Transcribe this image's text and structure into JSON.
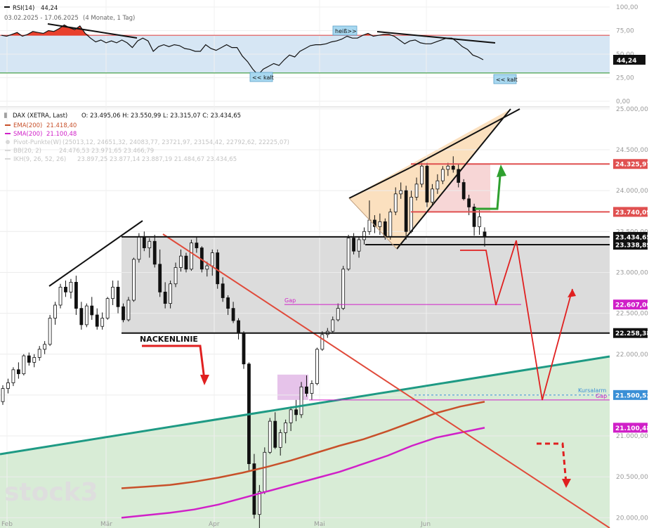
{
  "rsi_panel": {
    "title": "RSI(14)",
    "value": "44,24",
    "subtitle": "03.02.2025 - 17.06.2025",
    "subtitle_detail": "(4 Monate, 1 Tag)",
    "badge": "44,24",
    "labels": {
      "heiss": "heiß>>",
      "kalt1": "<< kalt",
      "kalt2": "<< kalt"
    }
  },
  "legend": {
    "main": {
      "name": "DAX (XETRA, Last)",
      "ohlc": "O: 23.495,06   H: 23.550,99   L: 23.315,07   C: 23.434,65"
    },
    "ema": {
      "name": "EMA(200)",
      "value": "21.418,40",
      "color": "#c8502a"
    },
    "sma": {
      "name": "SMA(200)",
      "value": "21.100,48",
      "color": "#d020c8"
    },
    "pivot": {
      "name": "Pivot-Punkte(W)",
      "value": "(25013,12, 24651,32, 24083,77, 23721,97, 23154,42, 22792,62, 22225,07)"
    },
    "bb": {
      "name": "BB(20, 2)",
      "value": "24.476,53  23.971,65  23.466,79"
    },
    "ikh": {
      "name": "IKH(9, 26, 52, 26)",
      "value": "23.897,25  23.877,14  23.887,19  21.484,67  23.434,65"
    }
  },
  "annotations": {
    "nackenlinie": "NACKENLINIE",
    "gap_upper": "Gap",
    "gap_lower": "Gap",
    "kursalarm": "Kursalarm"
  },
  "watermark": "stock3",
  "level_badges": [
    {
      "text": "24.325,97",
      "value": 24325.97,
      "color": "#e05050"
    },
    {
      "text": "23.740,09",
      "value": 23740.09,
      "color": "#e05050"
    },
    {
      "text": "23.434,65",
      "value": 23434.65,
      "color": "#111111"
    },
    {
      "text": "23.338,89",
      "value": 23338.89,
      "color": "#111111"
    },
    {
      "text": "22.607,00",
      "value": 22607.0,
      "color": "#d020c8"
    },
    {
      "text": "22.258,38",
      "value": 22258.38,
      "color": "#111111"
    },
    {
      "text": "21.500,53",
      "value": 21500.53,
      "color": "#3a8fd6"
    },
    {
      "text": "21.100,48",
      "value": 21100.48,
      "color": "#d020c8"
    }
  ],
  "chart_data": [
    {
      "type": "line",
      "title": "RSI(14)",
      "y_ticks": [
        "100,00",
        "75,00",
        "50,00",
        "25,00",
        "0,00"
      ],
      "y_values": [
        100,
        75,
        50,
        25,
        0
      ],
      "ylim": [
        0,
        100
      ],
      "overbought": 70,
      "oversold": 30,
      "series": [
        {
          "name": "RSI(14)",
          "values": [
            70,
            69,
            71,
            73,
            69,
            71,
            74,
            73,
            72,
            75,
            74,
            77,
            81,
            78,
            76,
            80,
            72,
            67,
            63,
            65,
            62,
            64,
            62,
            65,
            62,
            57,
            64,
            67,
            64,
            53,
            58,
            60,
            58,
            60,
            59,
            56,
            55,
            53,
            53,
            60,
            56,
            54,
            57,
            60,
            57,
            57,
            48,
            42,
            34,
            28,
            34,
            37,
            40,
            38,
            44,
            49,
            47,
            53,
            56,
            59,
            60,
            60,
            61,
            63,
            64,
            66,
            69,
            67,
            67,
            70,
            72,
            69,
            70,
            71,
            71,
            69,
            65,
            61,
            64,
            65,
            62,
            61,
            61,
            63,
            65,
            67,
            67,
            63,
            58,
            55,
            49,
            47,
            44
          ]
        }
      ]
    },
    {
      "type": "candlestick",
      "title": "DAX (XETRA, Last)",
      "x_ticks": [
        "Feb",
        "Mär",
        "Apr",
        "Mai",
        "Jun"
      ],
      "y_ticks": [
        "25.000,00",
        "24.500,00",
        "24.000,00",
        "23.500,00",
        "23.000,00",
        "22.500,00",
        "22.000,00",
        "21.500,00",
        "21.000,00",
        "20.500,00",
        "20.000,00"
      ],
      "y_values": [
        25000,
        24500,
        24000,
        23500,
        23000,
        22500,
        22000,
        21500,
        21000,
        20500,
        20000
      ],
      "ylim": [
        19950,
        25150
      ],
      "ohlc": [
        [
          21420,
          21620,
          21380,
          21580
        ],
        [
          21580,
          21700,
          21520,
          21650
        ],
        [
          21650,
          21840,
          21610,
          21810
        ],
        [
          21810,
          21900,
          21700,
          21760
        ],
        [
          21760,
          22000,
          21740,
          21980
        ],
        [
          21980,
          22020,
          21860,
          21900
        ],
        [
          21900,
          22000,
          21840,
          21960
        ],
        [
          21960,
          22100,
          21920,
          22060
        ],
        [
          22060,
          22160,
          22000,
          22120
        ],
        [
          22120,
          22480,
          22100,
          22440
        ],
        [
          22440,
          22640,
          22360,
          22600
        ],
        [
          22600,
          22860,
          22560,
          22820
        ],
        [
          22820,
          22900,
          22700,
          22760
        ],
        [
          22760,
          22920,
          22680,
          22880
        ],
        [
          22880,
          22960,
          22480,
          22560
        ],
        [
          22560,
          22640,
          22300,
          22360
        ],
        [
          22360,
          22620,
          22330,
          22590
        ],
        [
          22590,
          22700,
          22420,
          22480
        ],
        [
          22480,
          22560,
          22300,
          22340
        ],
        [
          22340,
          22510,
          22300,
          22440
        ],
        [
          22440,
          22700,
          22420,
          22680
        ],
        [
          22680,
          22900,
          22600,
          22820
        ],
        [
          22820,
          22900,
          22500,
          22580
        ],
        [
          22580,
          22620,
          22390,
          22420
        ],
        [
          22420,
          22700,
          22400,
          22660
        ],
        [
          22660,
          23180,
          22640,
          23160
        ],
        [
          23160,
          23480,
          23120,
          23440
        ],
        [
          23440,
          23500,
          23260,
          23300
        ],
        [
          23300,
          23420,
          23180,
          23380
        ],
        [
          23380,
          23460,
          23060,
          23100
        ],
        [
          23100,
          23280,
          22700,
          22760
        ],
        [
          22760,
          22880,
          22560,
          22620
        ],
        [
          22620,
          22900,
          22560,
          22860
        ],
        [
          22860,
          23120,
          22820,
          23060
        ],
        [
          23060,
          23280,
          23010,
          23200
        ],
        [
          23200,
          23240,
          23000,
          23040
        ],
        [
          23040,
          23400,
          23020,
          23360
        ],
        [
          23360,
          23440,
          23240,
          23300
        ],
        [
          23300,
          23320,
          23000,
          23040
        ],
        [
          23040,
          23130,
          22950,
          23080
        ],
        [
          23080,
          23280,
          22960,
          23240
        ],
        [
          23240,
          23280,
          22800,
          22860
        ],
        [
          22860,
          22940,
          22640,
          22690
        ],
        [
          22690,
          22720,
          22480,
          22560
        ],
        [
          22560,
          22640,
          22380,
          22410
        ],
        [
          22410,
          22440,
          22180,
          22260
        ],
        [
          22260,
          22280,
          21820,
          21880
        ],
        [
          21880,
          21900,
          20580,
          20660
        ],
        [
          20660,
          20780,
          19990,
          20040
        ],
        [
          20040,
          20400,
          19800,
          20320
        ],
        [
          20320,
          20860,
          20290,
          20800
        ],
        [
          20800,
          21220,
          20780,
          21180
        ],
        [
          21180,
          21290,
          20840,
          20860
        ],
        [
          20860,
          21080,
          20760,
          21040
        ],
        [
          21040,
          21200,
          20910,
          21160
        ],
        [
          21160,
          21360,
          21060,
          21320
        ],
        [
          21320,
          21440,
          21180,
          21260
        ],
        [
          21260,
          21660,
          21220,
          21600
        ],
        [
          21600,
          21740,
          21480,
          21520
        ],
        [
          21520,
          21680,
          21440,
          21640
        ],
        [
          21640,
          22080,
          21620,
          22060
        ],
        [
          22060,
          22280,
          22040,
          22240
        ],
        [
          22240,
          22320,
          22200,
          22280
        ],
        [
          22280,
          22460,
          22260,
          22420
        ],
        [
          22420,
          22620,
          22400,
          22560
        ],
        [
          22560,
          23080,
          22540,
          23040
        ],
        [
          23040,
          23460,
          23020,
          23420
        ],
        [
          23420,
          23480,
          23220,
          23260
        ],
        [
          23260,
          23440,
          23180,
          23400
        ],
        [
          23400,
          23550,
          23340,
          23500
        ],
        [
          23500,
          23880,
          23460,
          23640
        ],
        [
          23640,
          23700,
          23480,
          23560
        ],
        [
          23560,
          23720,
          23460,
          23620
        ],
        [
          23620,
          23660,
          23400,
          23440
        ],
        [
          23440,
          23780,
          23400,
          23740
        ],
        [
          23740,
          24040,
          23700,
          23960
        ],
        [
          23960,
          24100,
          23900,
          24000
        ],
        [
          24000,
          24060,
          23400,
          23500
        ],
        [
          23500,
          24000,
          23480,
          23920
        ],
        [
          23920,
          24160,
          23880,
          24080
        ],
        [
          24080,
          24340,
          24040,
          24300
        ],
        [
          24300,
          24340,
          23800,
          23860
        ],
        [
          23860,
          24080,
          23820,
          24020
        ],
        [
          24020,
          24200,
          23960,
          24120
        ],
        [
          24120,
          24300,
          24080,
          24260
        ],
        [
          24260,
          24340,
          24180,
          24300
        ],
        [
          24300,
          24420,
          24220,
          24260
        ],
        [
          24260,
          24330,
          24040,
          24100
        ],
        [
          24100,
          24140,
          23880,
          23900
        ],
        [
          23900,
          23950,
          23700,
          23800
        ],
        [
          23800,
          23840,
          23450,
          23560
        ],
        [
          23560,
          23760,
          23460,
          23680
        ],
        [
          23495.06,
          23550.99,
          23315.07,
          23434.65
        ]
      ],
      "series": [
        {
          "name": "EMA(200)",
          "values": [
            20360,
            20380,
            20400,
            20440,
            20490,
            20550,
            20620,
            20700,
            20790,
            20880,
            20960,
            21060,
            21170,
            21280,
            21360,
            21418.4
          ]
        },
        {
          "name": "SMA(200)",
          "values": [
            20000,
            20030,
            20060,
            20100,
            20160,
            20240,
            20320,
            20400,
            20480,
            20560,
            20660,
            20760,
            20880,
            20980,
            21040,
            21100.48
          ]
        }
      ]
    }
  ]
}
